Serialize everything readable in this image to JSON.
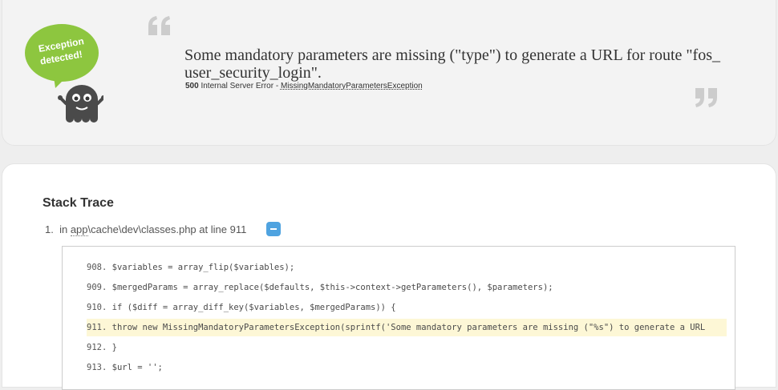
{
  "mascot": {
    "bubble_line1": "Exception",
    "bubble_line2": "detected!"
  },
  "exception": {
    "message": "Some mandatory parameters are missing (\"type\") to generate a URL for route \"fos_user_security_login\".",
    "status_code": "500",
    "status_text": "Internal Server Error -",
    "class_name": "MissingMandatoryParametersException"
  },
  "trace": {
    "title": "Stack Trace",
    "entry_number": "1.",
    "in_label": "in",
    "path_app": "app",
    "path_rest": "\\cache\\dev\\classes.php",
    "line_label": "at line 911",
    "code_lines": [
      {
        "num": "908.",
        "code": "$variables = array_flip($variables);"
      },
      {
        "num": "909.",
        "code": "$mergedParams = array_replace($defaults, $this->context->getParameters(), $parameters);"
      },
      {
        "num": "910.",
        "code": "if ($diff = array_diff_key($variables, $mergedParams)) {"
      },
      {
        "num": "911.",
        "code": "throw new MissingMandatoryParametersException(sprintf('Some mandatory parameters are missing (\"%s\") to generate a URL"
      },
      {
        "num": "912.",
        "code": "}"
      },
      {
        "num": "913.",
        "code": "$url = '';"
      }
    ]
  },
  "colors": {
    "accent_green": "#8dc63f",
    "toggle_blue": "#4fa3e0",
    "highlight": "#fdf7d6"
  }
}
